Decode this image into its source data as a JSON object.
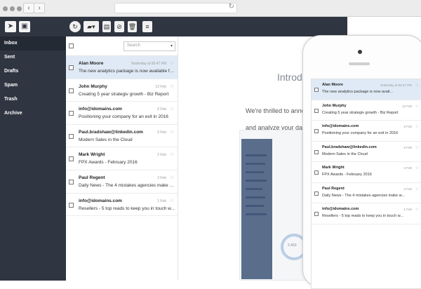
{
  "browser": {
    "back_icon": "chevron-left-icon",
    "forward_icon": "chevron-right-icon",
    "reload_icon": "reload-icon"
  },
  "nav": {
    "items": [
      {
        "label": "Inbox"
      },
      {
        "label": "Sent"
      },
      {
        "label": "Drafts"
      },
      {
        "label": "Spam"
      },
      {
        "label": "Trash"
      },
      {
        "label": "Archive"
      }
    ]
  },
  "list": {
    "search_placeholder": "Search",
    "emails": [
      {
        "from": "Alan Moore",
        "subject": "The new analytics package is now available fo...",
        "date": "Yesterday at 06:47 PM"
      },
      {
        "from": "John Murphy",
        "subject": "Creating 5 year strategiv growth - Biz Report",
        "date": "12 Feb"
      },
      {
        "from": "info@idomains.com",
        "subject": "Positioning your company for an exit in 2016",
        "date": "6 Feb"
      },
      {
        "from": "Paul.bradshaw@linkedin.com",
        "subject": "Modern Sales in the Cloud",
        "date": "5 Feb"
      },
      {
        "from": "Mark Wright",
        "subject": "FPX Awards - February 2016",
        "date": "2 Feb"
      },
      {
        "from": "Paul Regent",
        "subject": "Daily News - The 4 mistakes agencies make w...",
        "date": "2 Feb"
      },
      {
        "from": "info@idomains.com",
        "subject": "Resellers - 5 top reads to keep you in touch w...",
        "date": "1 Feb"
      }
    ]
  },
  "content": {
    "heading": "Introd",
    "line1": "We're thrilled to announ",
    "line2": "and analyze your data - A",
    "ring_value": "2,453"
  },
  "phone": {
    "emails": [
      {
        "from": "Alan Moore",
        "subject": "The new analytics package is now avail...",
        "date": "Yesterday at 06:47 PM"
      },
      {
        "from": "John Murphy",
        "subject": "Creating 5 year strategiv growth - Biz Report",
        "date": "12 Feb"
      },
      {
        "from": "info@idomains.com",
        "subject": "Positioning your company for an exit in 2016",
        "date": "6 Feb"
      },
      {
        "from": "Paul.bradshaw@linkedin.com",
        "subject": "Modern Sales in the Cloud",
        "date": "5 Feb"
      },
      {
        "from": "Mark Wright",
        "subject": "FPX Awards - February 2016",
        "date": "2 Feb"
      },
      {
        "from": "Paul Regent",
        "subject": "Daily News - The 4 mistakes agencies make w...",
        "date": "2 Feb"
      },
      {
        "from": "info@idomains.com",
        "subject": "Resellers - 5 top reads to keep you in touch w...",
        "date": "1 Feb"
      }
    ]
  }
}
